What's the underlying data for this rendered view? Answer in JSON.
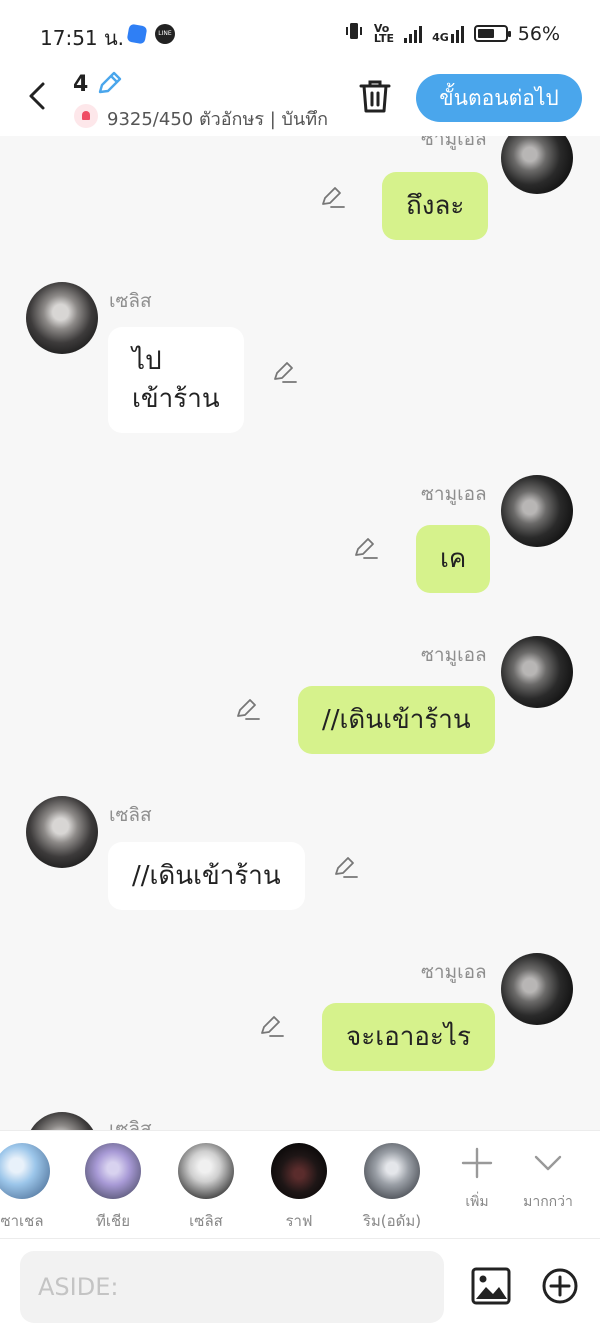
{
  "status": {
    "time": "17:51 น.",
    "battery": "56%",
    "net_a": "Vo",
    "net_b": "LTE",
    "net_c": "4G"
  },
  "header": {
    "episode": "4",
    "counter": "9325/450 ตัวอักษร | บันทึก",
    "next_label": "ขั้นตอนต่อไป"
  },
  "chat": {
    "top_partial_name": "ซามูเอล",
    "messages": [
      {
        "sender": "ซามูเอล",
        "text": "ถึงละ",
        "side": "right"
      },
      {
        "sender": "เซลิส",
        "text_lines": [
          "ไป",
          "เข้าร้าน"
        ],
        "side": "left"
      },
      {
        "sender": "ซามูเอล",
        "text": "เค",
        "side": "right"
      },
      {
        "sender": "ซามูเอล",
        "text": "//เดินเข้าร้าน",
        "side": "right"
      },
      {
        "sender": "เซลิส",
        "text": "//เดินเข้าร้าน",
        "side": "left"
      },
      {
        "sender": "ซามูเอล",
        "text": "จะเอาอะไร",
        "side": "right"
      }
    ],
    "bottom_partial_name": "เซลิส"
  },
  "characters": [
    {
      "name": "ซาเชล",
      "color": "#9cc6ea"
    },
    {
      "name": "ทีเชีย",
      "color": "#a89ad6"
    },
    {
      "name": "เซลิส",
      "color": "#cfcfcf"
    },
    {
      "name": "ราฟ",
      "color": "#1e1616"
    },
    {
      "name": "ริม(อดัม)",
      "color": "#9a9fa6"
    }
  ],
  "tools": {
    "add_label": "เพิ่ม",
    "more_label": "มากกว่า"
  },
  "composer": {
    "placeholder": "ASIDE:"
  },
  "colors": {
    "accent": "#4aa6ec",
    "my_bubble": "#d6f28c",
    "their_bubble": "#ffffff",
    "background": "#f7f7f7"
  }
}
